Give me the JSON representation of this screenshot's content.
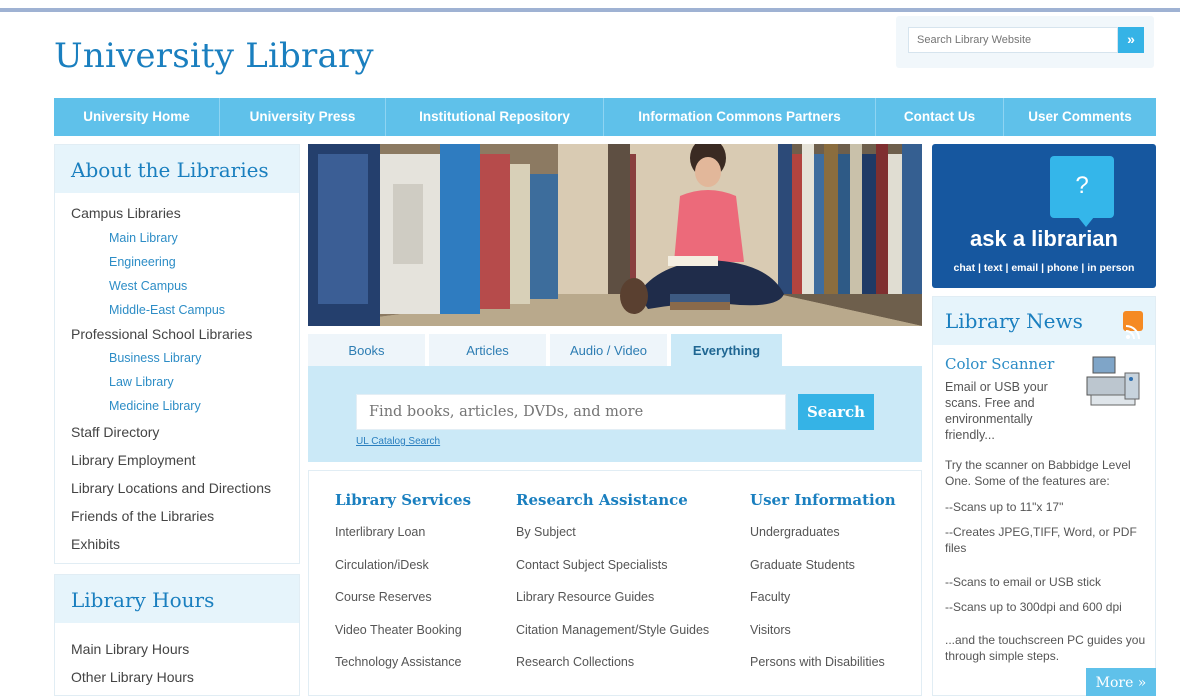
{
  "header": {
    "title": "University Library",
    "search_placeholder": "Search Library Website",
    "search_go": "»"
  },
  "nav": [
    "University Home",
    "University Press",
    "Institutional Repository",
    "Information Commons Partners",
    "Contact Us",
    "User Comments"
  ],
  "about": {
    "heading": "About the Libraries",
    "campus_libraries": "Campus Libraries",
    "campus_items": [
      "Main Library",
      "Engineering",
      "West Campus",
      "Middle-East Campus"
    ],
    "professional": "Professional School Libraries",
    "professional_items": [
      "Business Library",
      "Law Library",
      "Medicine Library"
    ],
    "other_items": [
      "Staff Directory",
      "Library Employment",
      "Library Locations and Directions",
      "Friends of the Libraries",
      "Exhibits"
    ]
  },
  "hours": {
    "heading": "Library Hours",
    "items": [
      "Main Library Hours",
      "Other Library Hours"
    ]
  },
  "search_tabs": {
    "tabs": [
      "Books",
      "Articles",
      "Audio / Video",
      "Everything"
    ],
    "active": "Everything",
    "placeholder": "Find books, articles, DVDs, and more",
    "button": "Search",
    "catalog_link": "UL Catalog Search"
  },
  "columns": [
    {
      "heading": "Library Services",
      "items": [
        "Interlibrary Loan",
        "Circulation/iDesk",
        "Course Reserves",
        "Video Theater Booking",
        "Technology Assistance"
      ]
    },
    {
      "heading": "Research Assistance",
      "items": [
        "By Subject",
        "Contact Subject Specialists",
        "Library Resource Guides",
        "Citation Management/Style Guides",
        "Research Collections"
      ]
    },
    {
      "heading": "User Information",
      "items": [
        "Undergraduates",
        "Graduate Students",
        "Faculty",
        "Visitors",
        "Persons with Disabilities"
      ]
    }
  ],
  "ask": {
    "bubble": "?",
    "title": "ask a librarian",
    "subtitle": "chat | text | email | phone | in person"
  },
  "news": {
    "heading": "Library News",
    "item_title": "Color Scanner",
    "intro": "Email or USB your scans. Free and environmentally friendly...",
    "paragraph": "Try the scanner on Babbidge Level One. Some of the features are:",
    "features": [
      "--Scans up to 11\"x 17\"",
      "--Creates JPEG,TIFF, Word, or PDF files",
      "--Scans to email or USB stick",
      "--Scans up to 300dpi and 600 dpi"
    ],
    "closing": "...and the touchscreen PC guides you through simple steps.",
    "more": "More »"
  },
  "colors": {
    "brand_blue": "#1a7fbf",
    "nav_blue": "#5fc1ea",
    "accent_blue": "#35b3e6",
    "ask_navy": "#16579f",
    "rss_orange": "#f58a23"
  }
}
